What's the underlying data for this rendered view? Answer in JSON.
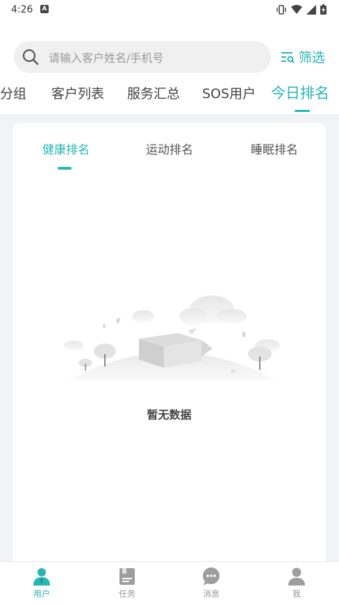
{
  "status": {
    "time": "4:26",
    "notification_badge": "A"
  },
  "search": {
    "placeholder": "请输入客户姓名/手机号",
    "filter_label": "筛选"
  },
  "tabs": [
    {
      "label": "客户分组",
      "active": false
    },
    {
      "label": "客户列表",
      "active": false
    },
    {
      "label": "服务汇总",
      "active": false
    },
    {
      "label": "SOS用户",
      "active": false
    },
    {
      "label": "今日排名",
      "active": true
    }
  ],
  "sub_tabs": [
    {
      "label": "健康排名",
      "active": true
    },
    {
      "label": "运动排名",
      "active": false
    },
    {
      "label": "睡眠排名",
      "active": false
    }
  ],
  "empty": {
    "message": "暂无数据"
  },
  "bottom_nav": [
    {
      "label": "用户",
      "icon": "user-badge-icon",
      "active": true
    },
    {
      "label": "任务",
      "icon": "task-icon",
      "active": false
    },
    {
      "label": "消息",
      "icon": "message-icon",
      "active": false
    },
    {
      "label": "我",
      "icon": "person-icon",
      "active": false
    }
  ],
  "colors": {
    "accent": "#26b6b3",
    "background": "#f1f3f4"
  }
}
